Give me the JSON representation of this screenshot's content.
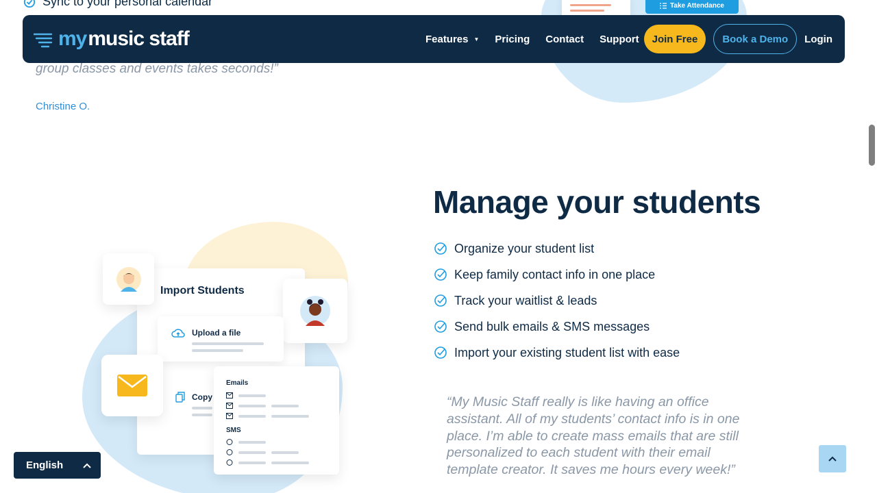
{
  "previous_section": {
    "check_item": "Sync to your personal calendar",
    "quote_tail": "group classes and events takes seconds!”",
    "author": "Christine O.",
    "attendance_button": "Take Attendance"
  },
  "navbar": {
    "logo_my": "my",
    "logo_rest": "music staff",
    "links": {
      "features": "Features",
      "pricing": "Pricing",
      "contact": "Contact",
      "support": "Support",
      "login": "Login"
    },
    "join_free": "Join Free",
    "book_demo": "Book a Demo"
  },
  "section": {
    "title": "Manage your students",
    "features": [
      "Organize your student list",
      "Keep family contact info in one place",
      "Track your waitlist & leads",
      "Send bulk emails & SMS messages",
      "Import your existing student list with ease"
    ],
    "quote": "“My Music Staff really is like having an office assistant. All of my students’ contact info is in one place. I’m able to create mass emails that are still personalized to each student with their email template creator. It saves me hours every week!”"
  },
  "illustration": {
    "panel_title": "Import Students",
    "upload_label": "Upload a file",
    "copy_label": "Copy",
    "emails_label": "Emails",
    "sms_label": "SMS"
  },
  "language": {
    "selected": "English"
  },
  "colors": {
    "navy": "#0f2a45",
    "accent_blue": "#4fb3ea",
    "yellow": "#f6b81c"
  }
}
